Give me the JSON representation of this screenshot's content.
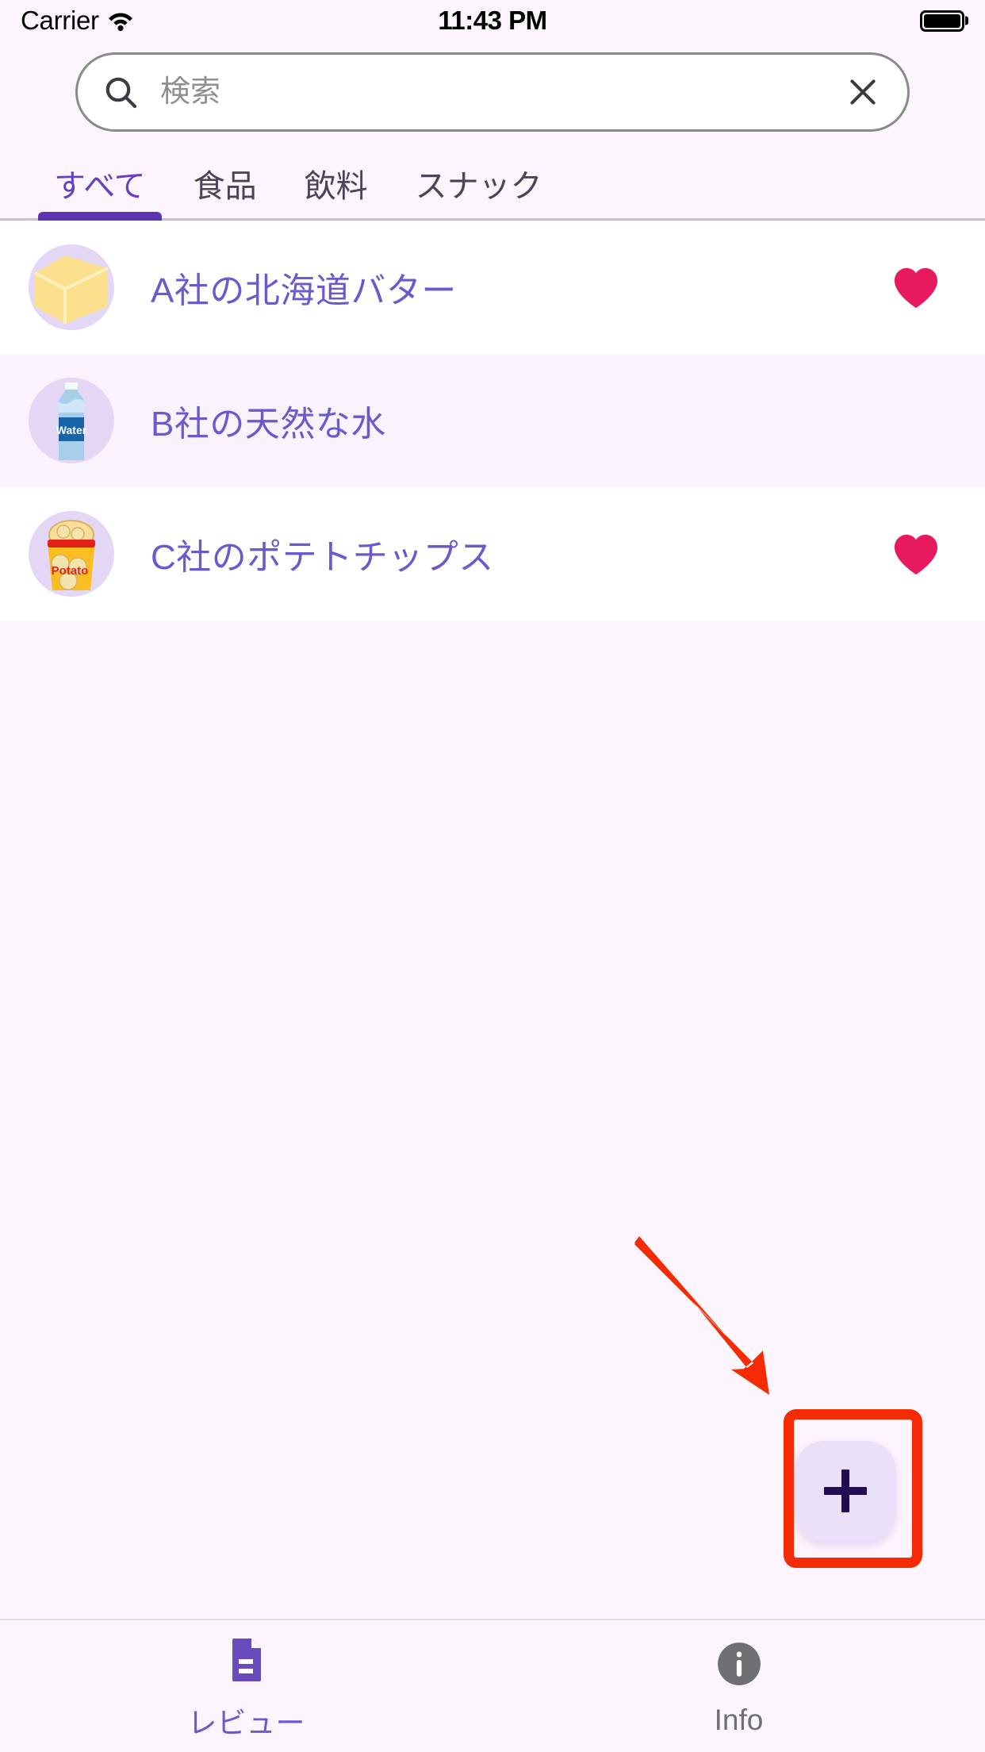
{
  "status_bar": {
    "carrier": "Carrier",
    "wifi_icon": "wifi-icon",
    "time": "11:43 PM",
    "battery_icon": "battery-full-icon"
  },
  "search": {
    "icon": "search-icon",
    "placeholder": "検索",
    "value": "",
    "clear_icon": "close-icon"
  },
  "tabs": [
    {
      "label": "すべて",
      "active": true
    },
    {
      "label": "食品",
      "active": false
    },
    {
      "label": "飲料",
      "active": false
    },
    {
      "label": "スナック",
      "active": false
    }
  ],
  "list": [
    {
      "title": "A社の北海道バター",
      "icon": "butter-block-icon",
      "favorite": true,
      "alt_row": false
    },
    {
      "title": "B社の天然な水",
      "icon": "water-bottle-icon",
      "favorite": false,
      "alt_row": true,
      "bottle_label": "Water"
    },
    {
      "title": "C社のポテトチップス",
      "icon": "potato-chips-icon",
      "favorite": true,
      "alt_row": false,
      "bag_label": "Potato"
    }
  ],
  "fab": {
    "icon": "plus-icon",
    "label": "+"
  },
  "annotations": {
    "arrow": "red-arrow-annotation",
    "highlight_box": "red-highlight-box-annotation"
  },
  "bottom_nav": [
    {
      "label": "レビュー",
      "icon": "document-icon",
      "active": true
    },
    {
      "label": "Info",
      "icon": "info-circle-icon",
      "active": false
    }
  ],
  "colors": {
    "background": "#FDF5FE",
    "accent_purple": "#5E35B1",
    "title_purple": "#6A5ACD",
    "heart_pink": "#E8195F",
    "annotation_red": "#F42B04",
    "fab_bg": "#EBE0FA"
  }
}
